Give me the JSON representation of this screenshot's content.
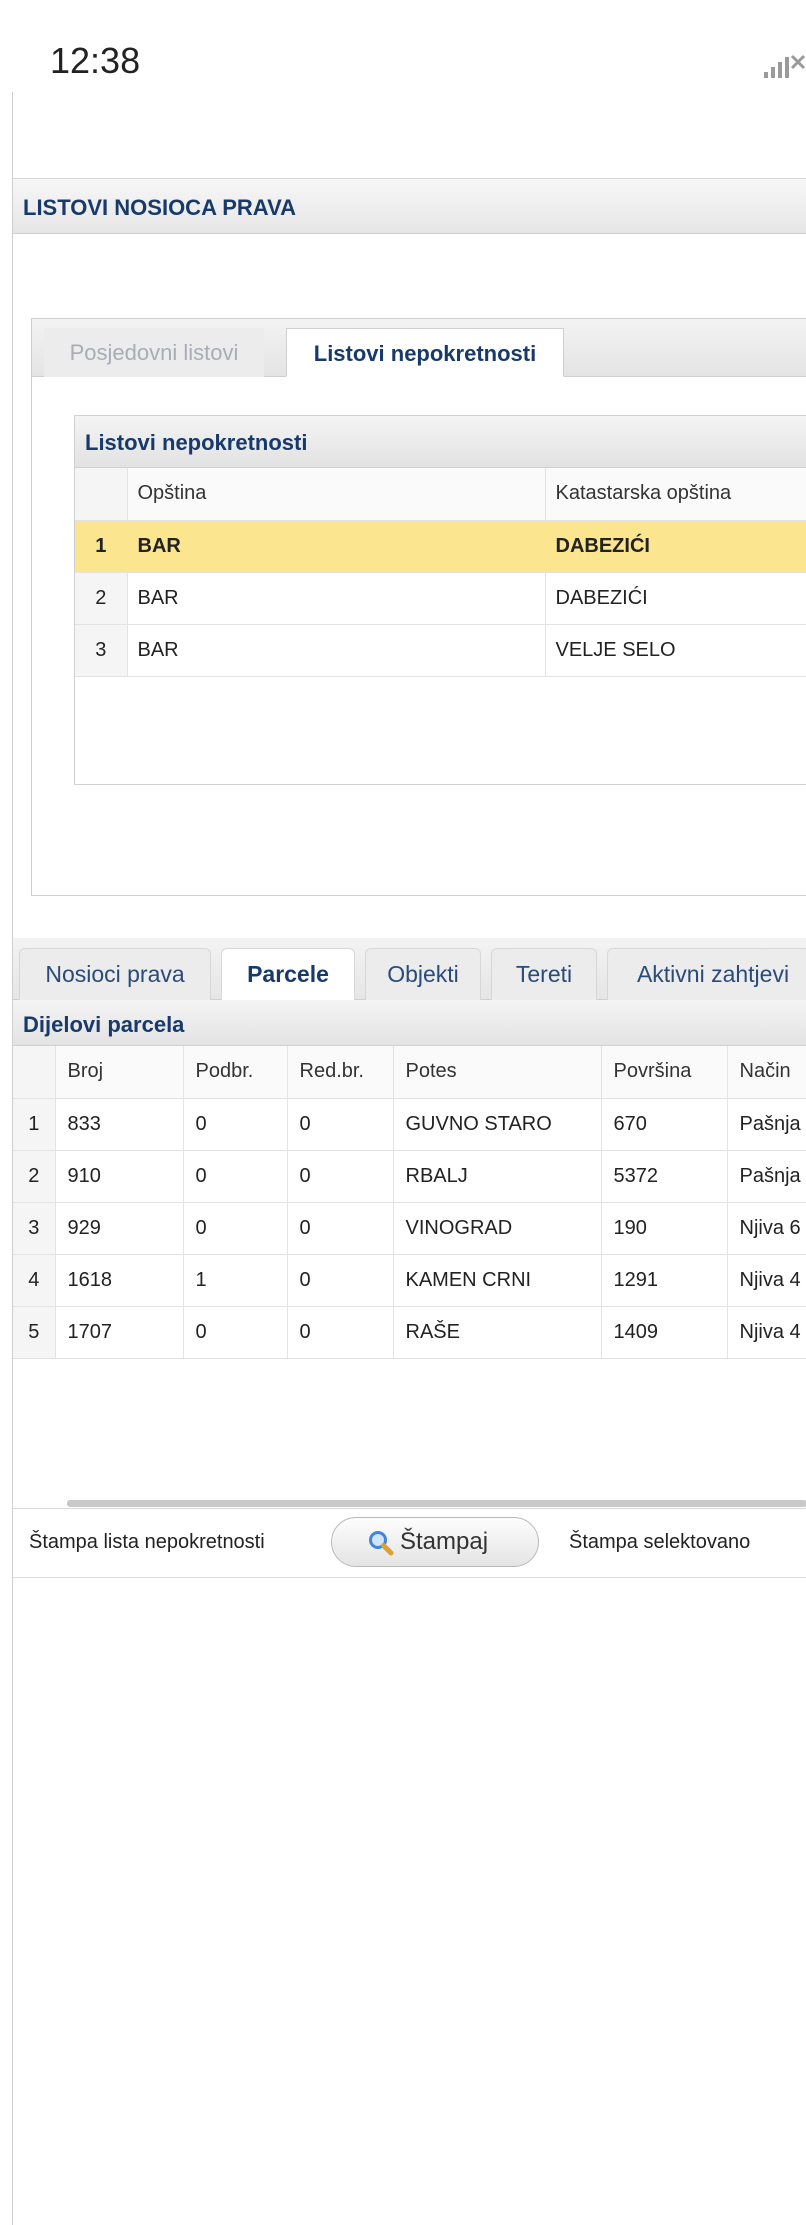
{
  "status_bar": {
    "time": "12:38"
  },
  "header": {
    "title": "LISTOVI NOSIOCA PRAVA"
  },
  "upper_tabs": [
    "Posjedovni listovi",
    "Listovi nepokretnosti"
  ],
  "listovi_grid": {
    "title": "Listovi nepokretnosti",
    "columns": [
      "",
      "Opština",
      "Katastarska opština"
    ],
    "rows": [
      [
        "1",
        "BAR",
        "DABEZIĆI"
      ],
      [
        "2",
        "BAR",
        "DABEZIĆI"
      ],
      [
        "3",
        "BAR",
        "VELJE SELO"
      ]
    ],
    "selected_row": 1
  },
  "lower_tabs": [
    "Nosioci prava",
    "Parcele",
    "Objekti",
    "Tereti",
    "Aktivni zahtjevi"
  ],
  "active_lower_tab": "Parcele",
  "parcele_grid": {
    "title": "Dijelovi parcela",
    "columns": [
      "",
      "Broj",
      "Podbr.",
      "Red.br.",
      "Potes",
      "Površina",
      "Način"
    ],
    "rows": [
      [
        "1",
        "833",
        "0",
        "0",
        "GUVNO STARO",
        "670",
        "Pašnja"
      ],
      [
        "2",
        "910",
        "0",
        "0",
        "RBALJ",
        "5372",
        "Pašnja"
      ],
      [
        "3",
        "929",
        "0",
        "0",
        "VINOGRAD",
        "190",
        "Njiva 6"
      ],
      [
        "4",
        "1618",
        "1",
        "0",
        "KAMEN CRNI",
        "1291",
        "Njiva 4"
      ],
      [
        "5",
        "1707",
        "0",
        "0",
        "RAŠE",
        "1409",
        "Njiva 4"
      ]
    ]
  },
  "footer": {
    "print_list_label": "Štampa lista nepokretnosti",
    "print_button_label": "Štampaj",
    "print_selected_label": "Štampa selektovano"
  },
  "icons": {
    "print_button_icon": "magnifier-icon",
    "signal_icon": "no-signal-icon"
  },
  "colors": {
    "title_text": "#173a6b",
    "selected_row": "#fbe58f"
  }
}
